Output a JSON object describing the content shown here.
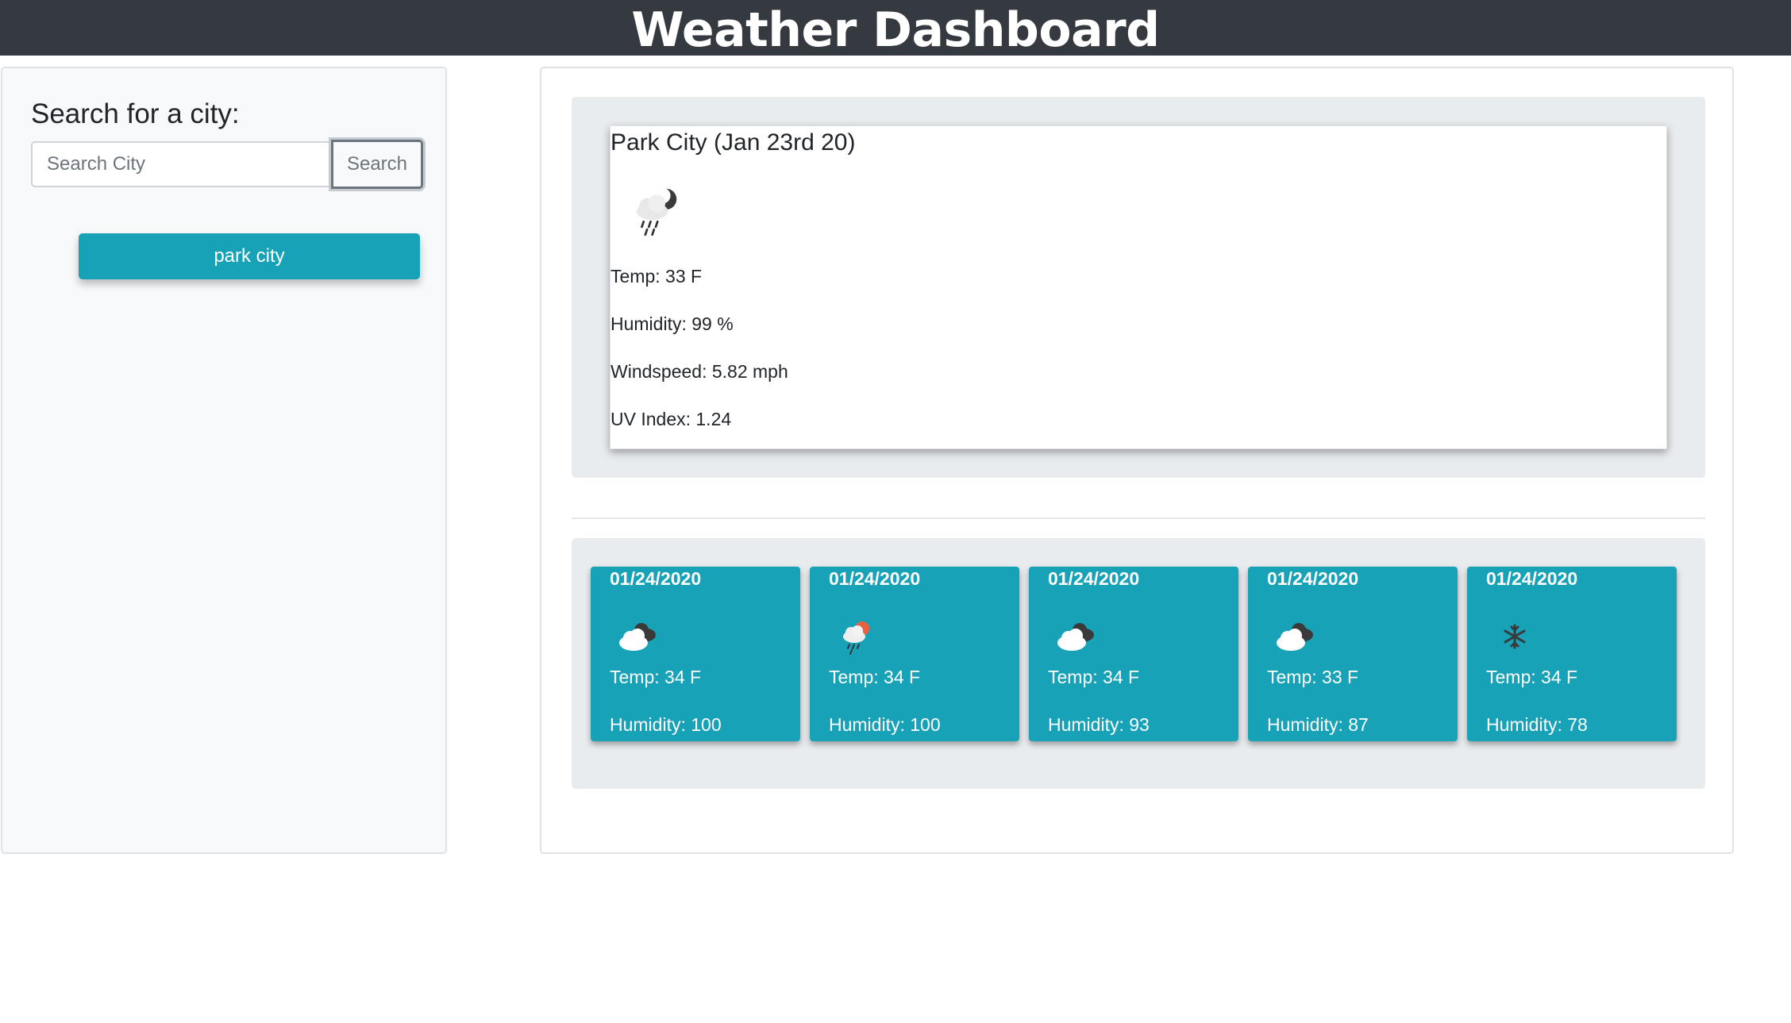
{
  "header": {
    "title": "Weather Dashboard"
  },
  "sidebar": {
    "heading": "Search for a city:",
    "search_placeholder": "Search City",
    "search_value": "",
    "search_button": "Search",
    "history": [
      "park city"
    ]
  },
  "current": {
    "title": "Park City (Jan 23rd 20)",
    "icon": "rain-night-icon",
    "temp": "Temp: 33 F",
    "humidity": "Humidity: 99 %",
    "windspeed": "Windspeed: 5.82 mph",
    "uv_index": "UV Index: 1.24"
  },
  "forecast": [
    {
      "date": "01/24/2020",
      "icon": "broken-clouds-icon",
      "temp": "Temp: 34 F",
      "humidity": "Humidity: 100"
    },
    {
      "date": "01/24/2020",
      "icon": "rain-sun-icon",
      "temp": "Temp: 34 F",
      "humidity": "Humidity: 100"
    },
    {
      "date": "01/24/2020",
      "icon": "broken-clouds-icon",
      "temp": "Temp: 34 F",
      "humidity": "Humidity: 93"
    },
    {
      "date": "01/24/2020",
      "icon": "broken-clouds-icon",
      "temp": "Temp: 33 F",
      "humidity": "Humidity: 87"
    },
    {
      "date": "01/24/2020",
      "icon": "snowflake-icon",
      "temp": "Temp: 34 F",
      "humidity": "Humidity: 78"
    }
  ],
  "colors": {
    "header_bg": "#343a40",
    "accent": "#17a2b8",
    "jumbotron_bg": "#e9ecef"
  }
}
